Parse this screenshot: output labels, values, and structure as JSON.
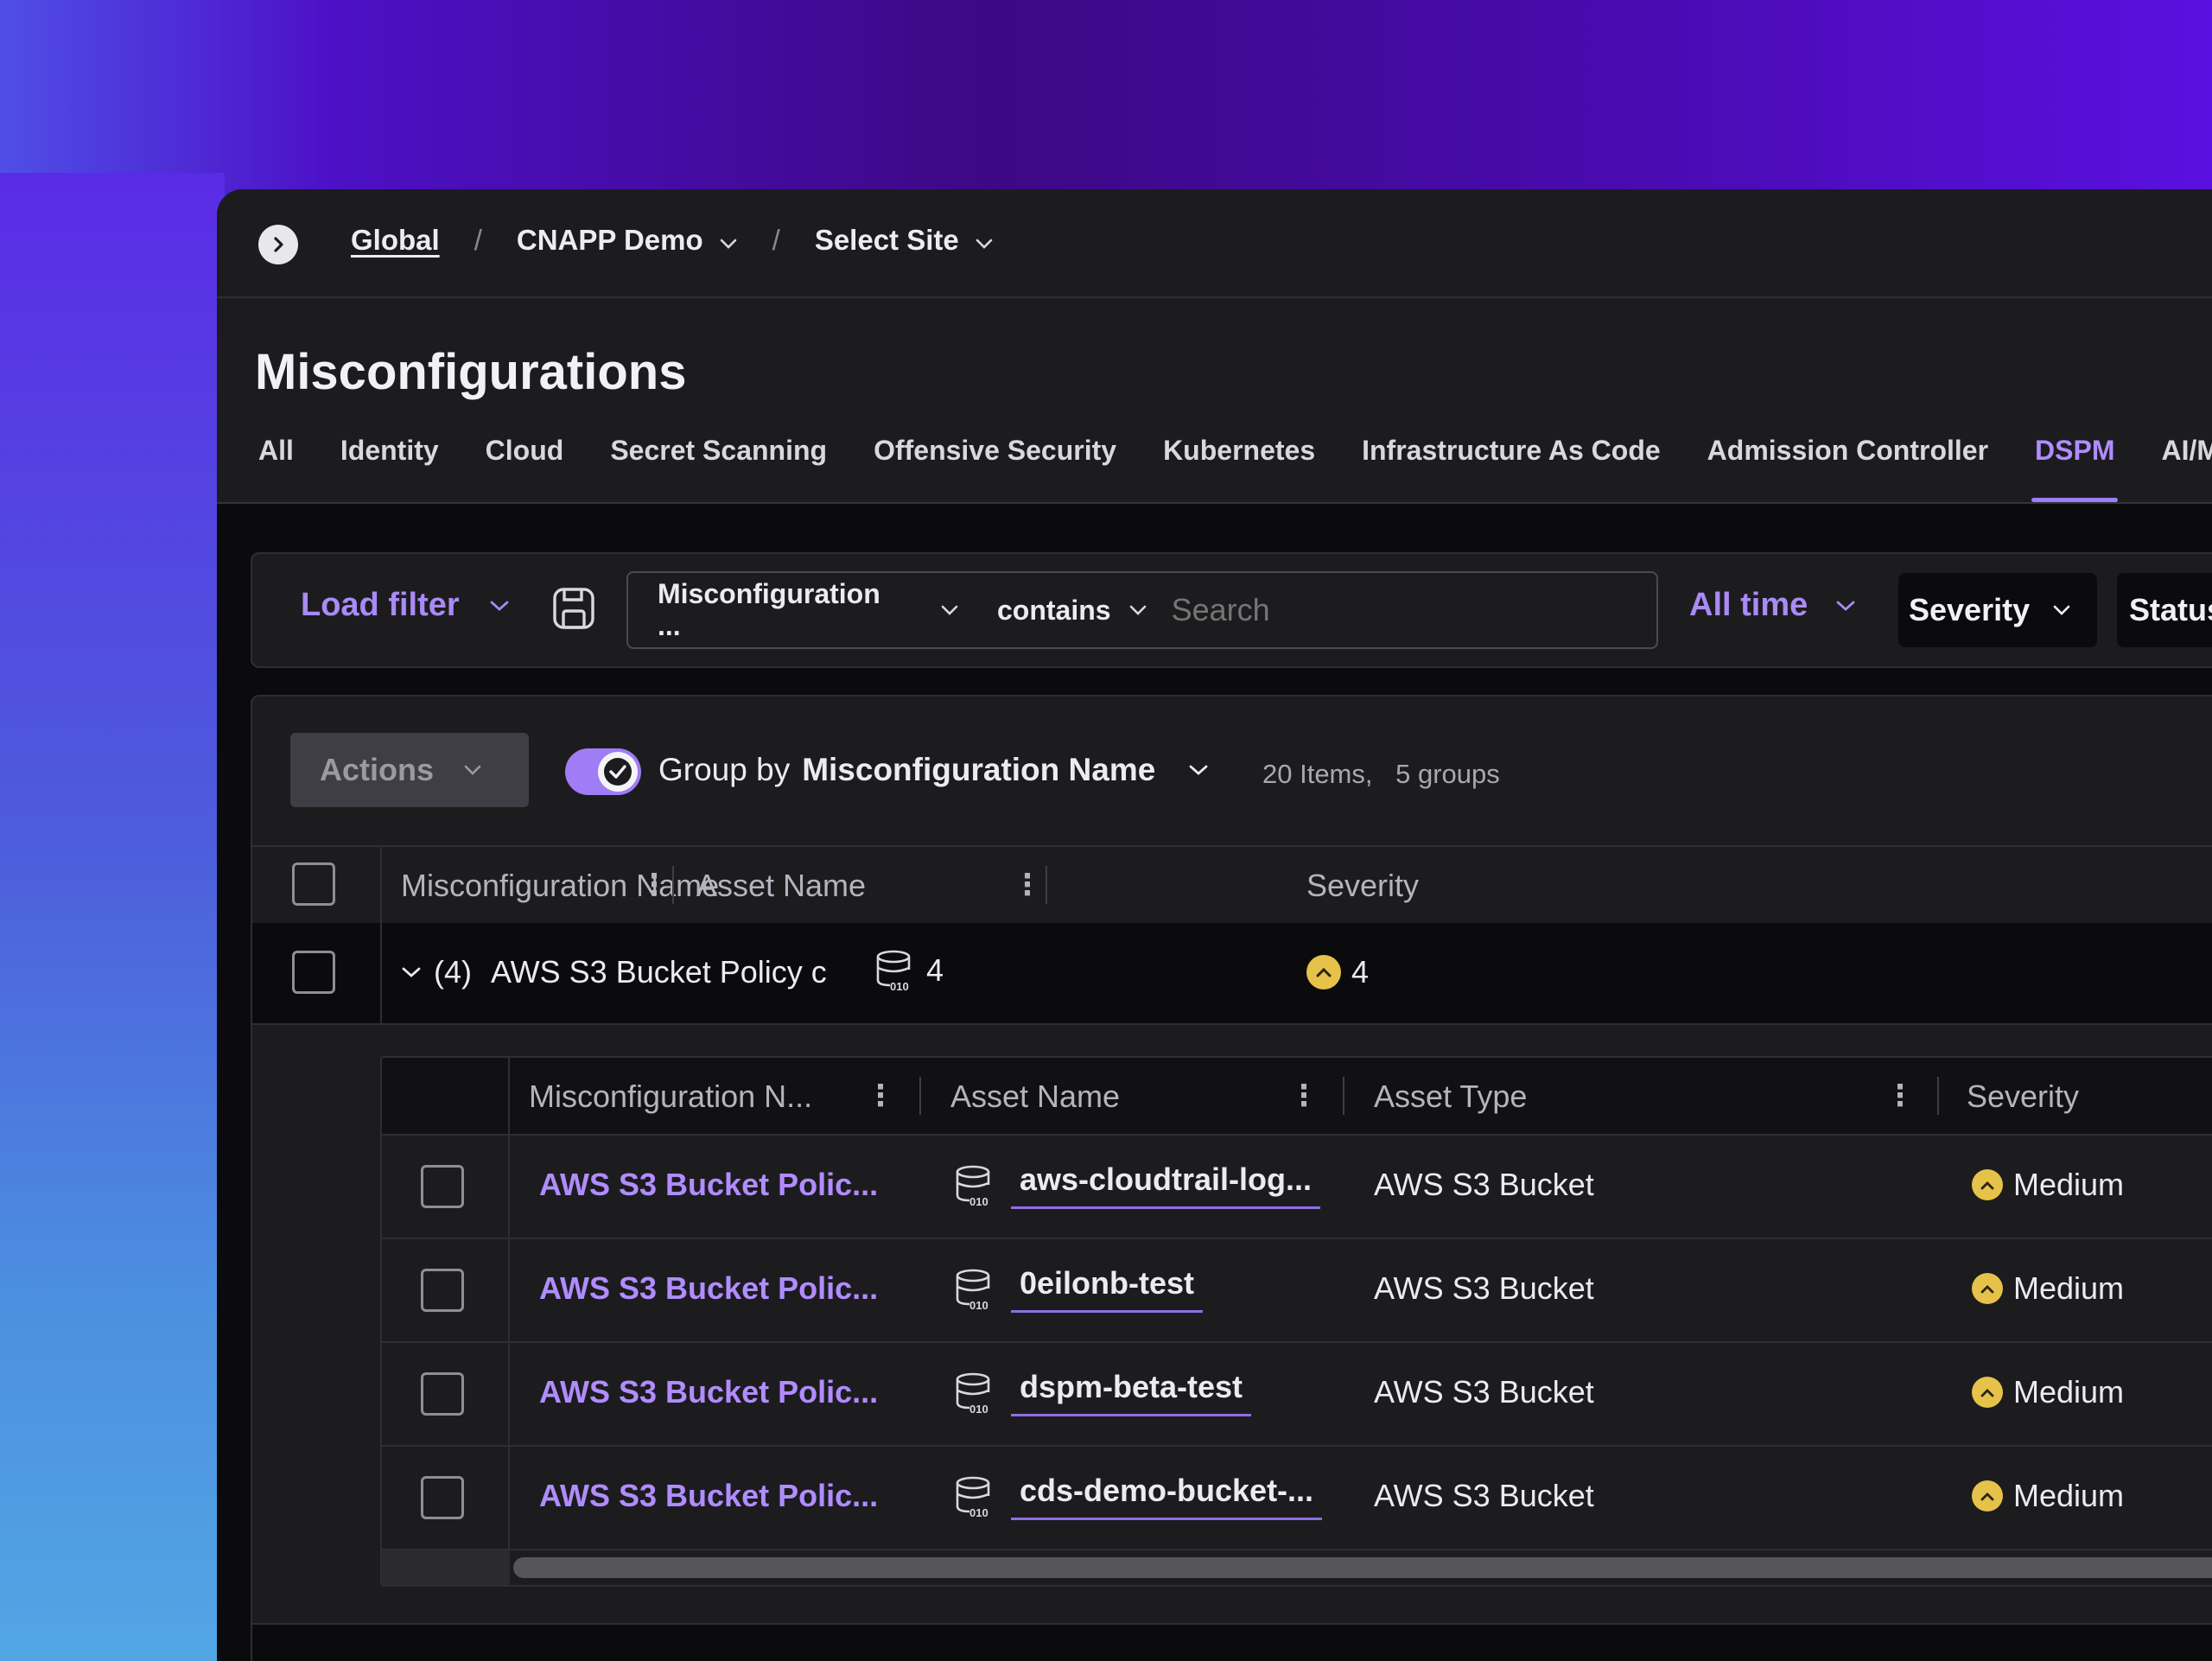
{
  "breadcrumb": {
    "global": "Global",
    "separator": "/",
    "account": "CNAPP Demo",
    "site": "Select Site"
  },
  "page": {
    "title": "Misconfigurations"
  },
  "tabs": [
    {
      "label": "All",
      "active": false
    },
    {
      "label": "Identity",
      "active": false
    },
    {
      "label": "Cloud",
      "active": false
    },
    {
      "label": "Secret Scanning",
      "active": false
    },
    {
      "label": "Offensive Security",
      "active": false
    },
    {
      "label": "Kubernetes",
      "active": false
    },
    {
      "label": "Infrastructure As Code",
      "active": false
    },
    {
      "label": "Admission Controller",
      "active": false
    },
    {
      "label": "DSPM",
      "active": true
    },
    {
      "label": "AI/ML",
      "active": false
    }
  ],
  "filters": {
    "load_filter": "Load filter",
    "field": "Misconfiguration ...",
    "operator": "contains",
    "search_placeholder": "Search",
    "time_range": "All time",
    "severity": "Severity",
    "status": "Status"
  },
  "toolbar": {
    "actions": "Actions",
    "group_by_label": "Group by",
    "group_by_value": "Misconfiguration Name",
    "items_count": "20 Items,",
    "groups_count": "5 groups"
  },
  "table": {
    "headers": [
      "Misconfiguration Name",
      "Asset Name",
      "Severity"
    ]
  },
  "group": {
    "expander": "(4)",
    "name": "AWS S3 Bucket Policy c",
    "asset_count": "4",
    "severity_count": "4"
  },
  "nested": {
    "headers": [
      "Misconfiguration N...",
      "Asset Name",
      "Asset Type",
      "Severity"
    ],
    "rows": [
      {
        "misconfiguration": "AWS S3 Bucket Polic...",
        "asset": "aws-cloudtrail-log...",
        "type": "AWS S3 Bucket",
        "severity": "Medium"
      },
      {
        "misconfiguration": "AWS S3 Bucket Polic...",
        "asset": "0eilonb-test",
        "type": "AWS S3 Bucket",
        "severity": "Medium"
      },
      {
        "misconfiguration": "AWS S3 Bucket Polic...",
        "asset": "dspm-beta-test",
        "type": "AWS S3 Bucket",
        "severity": "Medium"
      },
      {
        "misconfiguration": "AWS S3 Bucket Polic...",
        "asset": "cds-demo-bucket-...",
        "type": "AWS S3 Bucket",
        "severity": "Medium"
      }
    ]
  },
  "colors": {
    "accent": "#a07cf6",
    "link": "#b18cff",
    "severity_medium": "#e6c24a",
    "surface": "#1c1c1f",
    "background": "#0b0b0d"
  },
  "icons": {
    "nav_toggle": "chevron-right-circle-icon",
    "dropdown": "chevron-down-icon",
    "save": "save-filter-icon",
    "asset": "database-bucket-icon",
    "severity": "severity-medium-icon",
    "check": "checkmark-icon",
    "kebab": "kebab-menu-icon"
  }
}
